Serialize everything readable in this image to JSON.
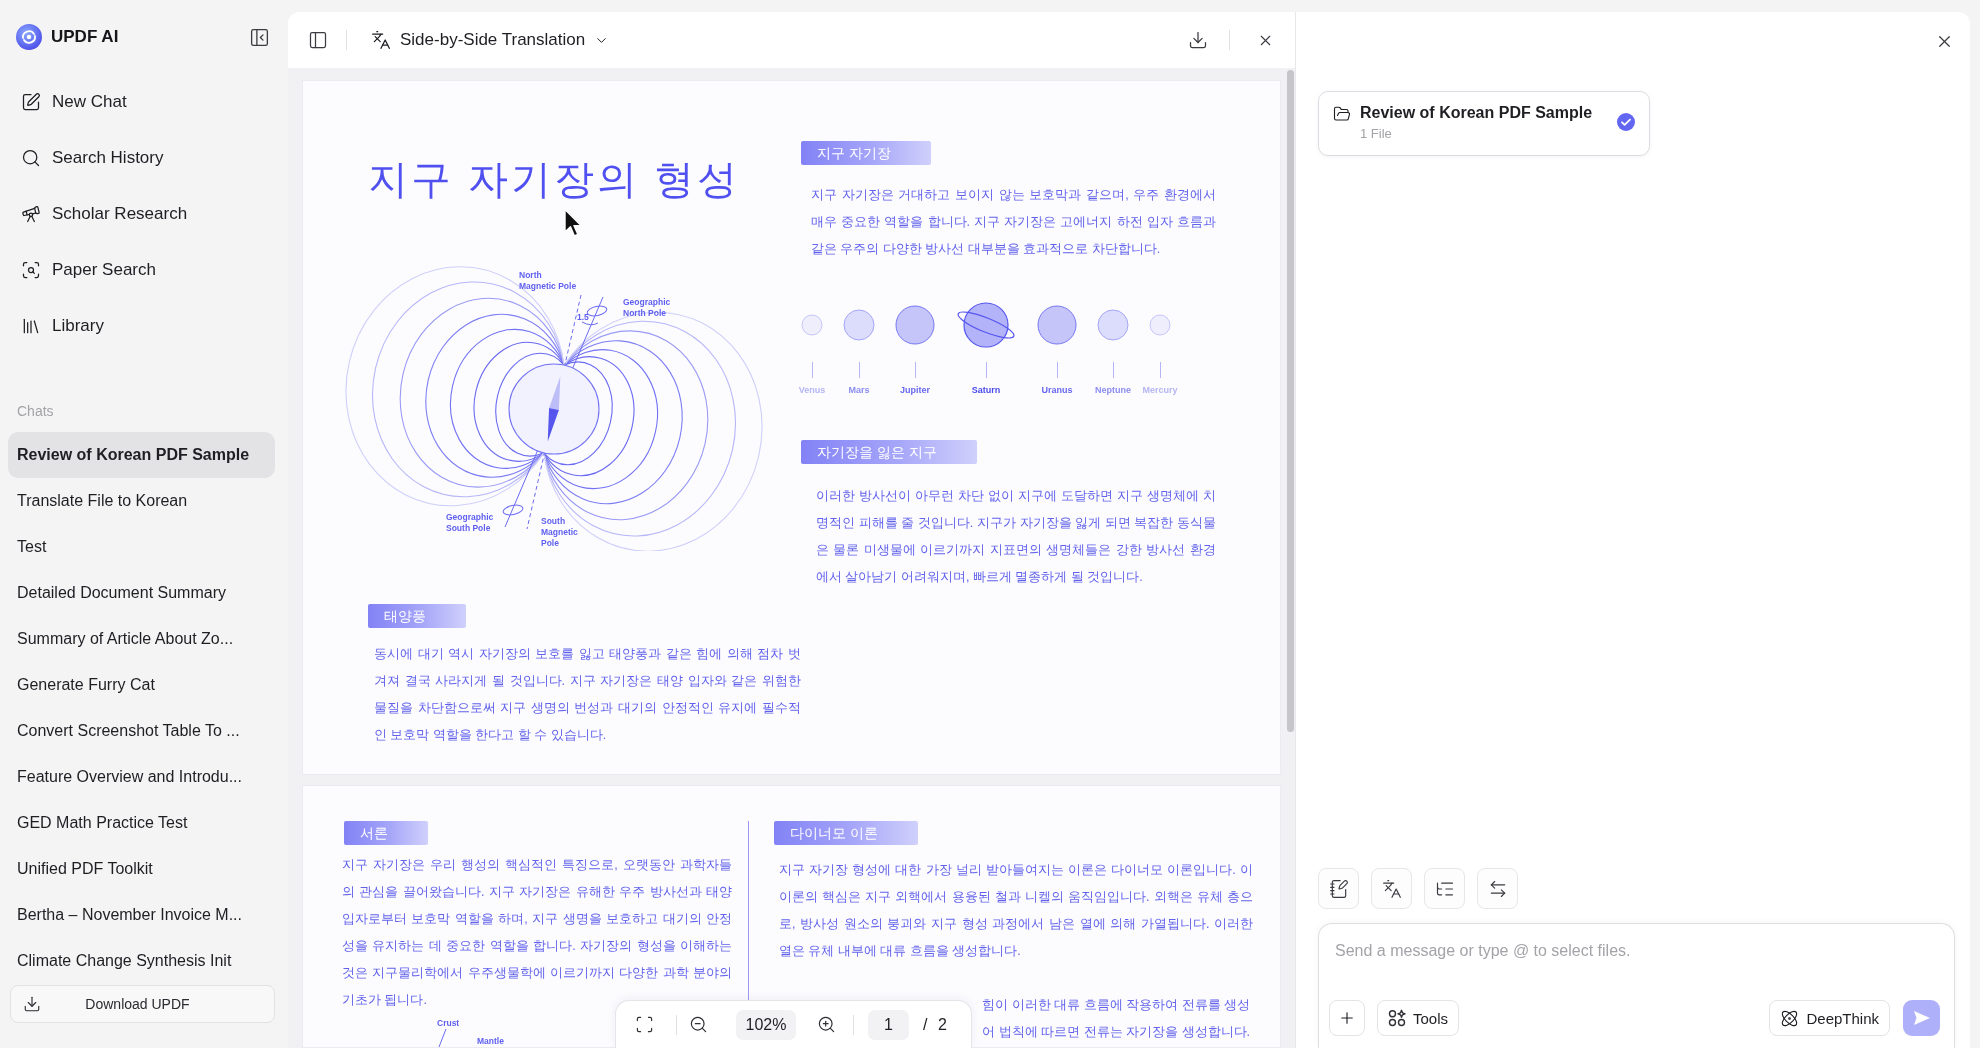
{
  "sidebar": {
    "logo": "UPDF AI",
    "nav": [
      "New Chat",
      "Search History",
      "Scholar Research",
      "Paper Search",
      "Library"
    ],
    "chats_heading": "Chats",
    "chats": [
      {
        "title": "Review of Korean PDF Sample",
        "selected": true
      },
      {
        "title": "Translate File to Korean",
        "selected": false
      },
      {
        "title": "Test",
        "selected": false
      },
      {
        "title": "Detailed Document Summary",
        "selected": false
      },
      {
        "title": "Summary of Article About Zo...",
        "selected": false
      },
      {
        "title": "Generate Furry Cat",
        "selected": false
      },
      {
        "title": "Convert Screenshot Table To ...",
        "selected": false
      },
      {
        "title": "Feature Overview and Introdu...",
        "selected": false
      },
      {
        "title": "GED Math Practice Test",
        "selected": false
      },
      {
        "title": "Unified PDF Toolkit",
        "selected": false
      },
      {
        "title": "Bertha – November Invoice M...",
        "selected": false
      },
      {
        "title": "Climate Change Synthesis Init",
        "selected": false
      }
    ],
    "download_button": "Download UPDF"
  },
  "document": {
    "header": {
      "title": "Side-by-Side Translation"
    },
    "page_1": {
      "title": "지구 자기장의 형성",
      "field_diagram": {
        "north_magnetic_pole": [
          "North",
          "Magnetic Pole"
        ],
        "geographic_north_pole": [
          "Geographic",
          "North Pole"
        ],
        "tilt_angle": "1.5",
        "geographic_south_pole": [
          "Geographic",
          "South Pole"
        ],
        "south_magnetic_pole": [
          "South",
          "Magnetic",
          "Pole"
        ]
      },
      "magnetic_field": {
        "heading": "지구 자기장",
        "text": "지구 자기장은 거대하고 보이지 않는 보호막과 같으며, 우주 환경에서 매우 중요한 역할을 합니다. 지구 자기장은 고에너지 하전 입자 흐름과 같은 우주의 다양한 방사선 대부분을 효과적으로 차단합니다."
      },
      "planets": [
        {
          "name": "Venus",
          "kind": "small"
        },
        {
          "name": "Mars",
          "kind": "medium"
        },
        {
          "name": "Jupiter",
          "kind": "large"
        },
        {
          "name": "Saturn",
          "kind": "ringed"
        },
        {
          "name": "Uranus",
          "kind": "large"
        },
        {
          "name": "Neptune",
          "kind": "medium"
        },
        {
          "name": "Mercury",
          "kind": "small"
        }
      ],
      "field_loss": {
        "heading": "자기장을 잃은 지구",
        "text": "이러한 방사선이 아무런 차단 없이 지구에 도달하면 지구 생명체에 치명적인 피해를 줄 것입니다. 지구가 자기장을 잃게 되면 복잡한 동식물은 물론 미생물에 이르기까지 지표면의 생명체들은 강한 방사선 환경에서 살아남기 어려워지며, 빠르게 멸종하게 될 것입니다."
      },
      "solar_wind": {
        "heading": "태양풍",
        "text": "동시에 대기 역시 자기장의 보호를 잃고 태양풍과 같은 힘에 의해 점차 벗겨져 결국 사라지게 될 것입니다. 지구 자기장은 태양 입자와 같은 위험한 물질을 차단함으로써 지구 생명의 번성과 대기의 안정적인 유지에 필수적인 보호막 역할을 한다고 할 수 있습니다."
      }
    },
    "page_2": {
      "introduction": {
        "heading": "서론",
        "text": "지구 자기장은 우리 행성의 핵심적인 특징으로, 오랫동안 과학자들의 관심을 끌어왔습니다. 지구 자기장은 유해한 우주 방사선과 태양 입자로부터 보호막 역할을 하며, 지구 생명을 보호하고 대기의 안정성을 유지하는 데 중요한 역할을 합니다. 자기장의 형성을 이해하는 것은 지구물리학에서 우주생물학에 이르기까지 다양한 과학 분야의 기초가 됩니다."
      },
      "layer_labels": [
        "Crust",
        "Mantle"
      ],
      "dynamo_theory": {
        "heading": "다이너모 이론",
        "text": "지구 자기장 형성에 대한 가장 널리 받아들여지는 이론은 다이너모 이론입니다. 이 이론의 핵심은 지구 외핵에서 용융된 철과 니켈의 움직임입니다. 외핵은 유체 층으로, 방사성 원소의 붕괴와 지구 형성 과정에서 남은 열에 의해 가열됩니다. 이러한 열은 유체 내부에 대류 흐름을 생성합니다.",
        "covered_lines": [
          "힘이 이러한 대류 흐름에 작용하여 전류를 생성",
          "어 법칙에 따르면 전류는 자기장을 생성합니다."
        ]
      }
    },
    "zoom_bar": {
      "zoom": "102%",
      "page": "1",
      "page_total": "/ 2"
    }
  },
  "chat_panel": {
    "file_card": {
      "title": "Review of Korean PDF Sample",
      "subtitle": "1 File",
      "selected": true
    },
    "message_input": {
      "placeholder": "Send a message or type @ to select files."
    },
    "tools_button": "Tools",
    "deepthink_button": "DeepThink",
    "send_button": {
      "disabled": true
    }
  }
}
